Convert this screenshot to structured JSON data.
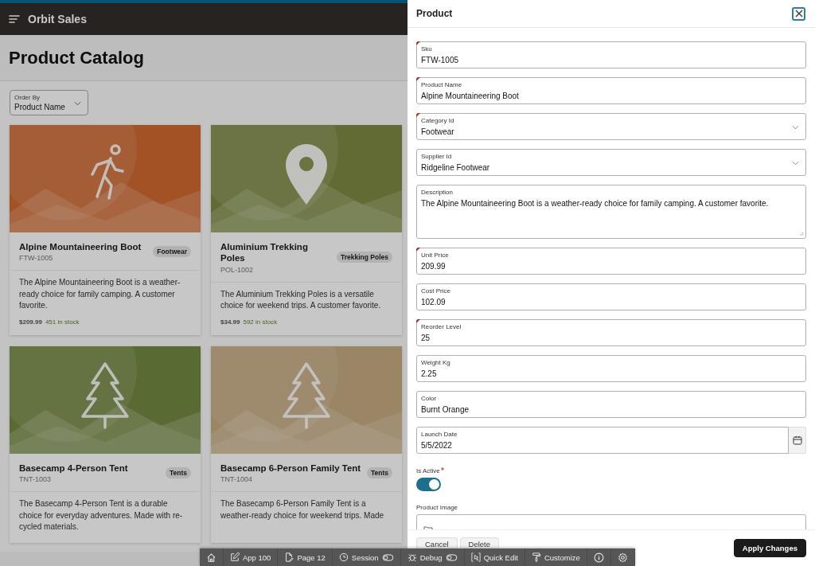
{
  "header": {
    "app_title": "Orbit Sales"
  },
  "page": {
    "title": "Product Catalog"
  },
  "order_by": {
    "label": "Order By",
    "value": "Product Name"
  },
  "cards": [
    {
      "title": "Alpine Mountaineering Boot",
      "sku": "FTW-1005",
      "category": "Footwear",
      "description": "The Alpine Mountaineering Boot is a weather-ready choice for family camping. A customer favorite.",
      "price": "$209.99",
      "stock": "451 in stock",
      "kind": "hiker"
    },
    {
      "title": "Aluminium Trekking Poles",
      "sku": "POL-1002",
      "category": "Trekking Poles",
      "description": "The Aluminium Trekking Poles is a versatile choice for weekend trips. A customer favorite.",
      "price": "$34.99",
      "stock": "592 in stock",
      "kind": "pin"
    },
    {
      "title": "Basecamp 4-Person Tent",
      "sku": "TNT-1003",
      "category": "Tents",
      "description": "The Basecamp 4-Person Tent is a durable choice for everyday adventures. Made with re-cycled materials.",
      "kind": "tree"
    },
    {
      "title": "Basecamp 6-Person Family Tent",
      "sku": "TNT-1004",
      "category": "Tents",
      "description": "The Basecamp 6-Person Family Tent is a weather-ready choice for weekend trips. Made",
      "kind": "tree"
    }
  ],
  "drawer": {
    "title": "Product",
    "fields": [
      {
        "kind": "text",
        "label": "Sku",
        "value": "FTW-1005",
        "required": true
      },
      {
        "kind": "text",
        "label": "Product Name",
        "value": "Alpine Mountaineering Boot",
        "required": true
      },
      {
        "kind": "select",
        "label": "Category Id",
        "value": "Footwear",
        "required": true
      },
      {
        "kind": "select",
        "label": "Supplier Id",
        "value": "Ridgeline Footwear",
        "required": false
      },
      {
        "kind": "textarea",
        "label": "Description",
        "value": "The Alpine Mountaineering Boot is a weather-ready choice for family camping. A customer favorite.",
        "required": false
      },
      {
        "kind": "text",
        "label": "Unit Price",
        "value": "209.99",
        "required": true
      },
      {
        "kind": "text",
        "label": "Cost Price",
        "value": "102.09",
        "required": false
      },
      {
        "kind": "text",
        "label": "Reorder Level",
        "value": "25",
        "required": true
      },
      {
        "kind": "text",
        "label": "Weight Kg",
        "value": "2.25",
        "required": false
      },
      {
        "kind": "text",
        "label": "Color",
        "value": "Burnt Orange",
        "required": false
      },
      {
        "kind": "date",
        "label": "Launch Date",
        "value": "5/5/2022",
        "required": false
      }
    ],
    "switch": {
      "label": "Is Active",
      "on": true,
      "required": true
    },
    "image_field": {
      "label": "Product Image"
    },
    "buttons": [
      {
        "label": "Cancel",
        "kind": "secondary"
      },
      {
        "label": "Delete",
        "kind": "secondary"
      },
      {
        "label": "Apply Changes",
        "kind": "primary"
      }
    ]
  },
  "dev_toolbar": [
    {
      "kind": "home",
      "toggle": false
    },
    {
      "kind": "app",
      "label": "App 100",
      "toggle": false
    },
    {
      "kind": "page",
      "label": "Page 12",
      "toggle": false
    },
    {
      "kind": "session",
      "label": "Session",
      "toggle": true
    },
    {
      "kind": "debug",
      "label": "Debug",
      "toggle": true
    },
    {
      "kind": "quick_edit",
      "label": "Quick Edit",
      "toggle": false
    },
    {
      "kind": "customize",
      "label": "Customize",
      "toggle": false
    },
    {
      "kind": "info",
      "toggle": false
    },
    {
      "kind": "settings",
      "toggle": false
    }
  ]
}
